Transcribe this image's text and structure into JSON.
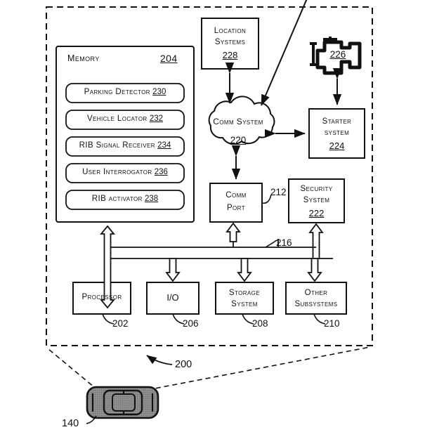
{
  "figure": {
    "system_ref": "200",
    "vehicle_ref": "140",
    "bus_ref": "216",
    "port_ref": "212"
  },
  "memory": {
    "title": "Memory",
    "ref": "204",
    "modules": [
      {
        "label": "Parking Detector",
        "ref": "230"
      },
      {
        "label": "Vehicle Locator",
        "ref": "232"
      },
      {
        "label": "RIB Signal Receiver",
        "ref": "234"
      },
      {
        "label": "User Interrogator",
        "ref": "236"
      },
      {
        "label": "RIB activator",
        "ref": "238"
      }
    ]
  },
  "blocks": {
    "location_systems": {
      "line1": "Location",
      "line2": "Systems",
      "ref": "228"
    },
    "comm_system": {
      "label": "Comm System",
      "ref": "220"
    },
    "engine": {
      "ref": "226",
      "icon": "engine-icon"
    },
    "starter_system": {
      "line1": "Starter",
      "line2": "system",
      "ref": "224"
    },
    "comm_port": {
      "line1": "Comm",
      "line2": "Port",
      "ref": "212"
    },
    "security_system": {
      "line1": "Security",
      "line2": "System",
      "ref": "222"
    },
    "processor": {
      "label": "Processor",
      "ref": "202"
    },
    "io": {
      "label": "I/O",
      "ref": "206"
    },
    "storage_system": {
      "line1": "Storage",
      "line2": "System",
      "ref": "208"
    },
    "other_subsystems": {
      "line1": "Other",
      "line2": "Subsystems",
      "ref": "210"
    }
  },
  "colors": {
    "stroke": "#111111",
    "car_body": "#7f7f7f",
    "car_outline": "#111111",
    "background": "#ffffff"
  }
}
